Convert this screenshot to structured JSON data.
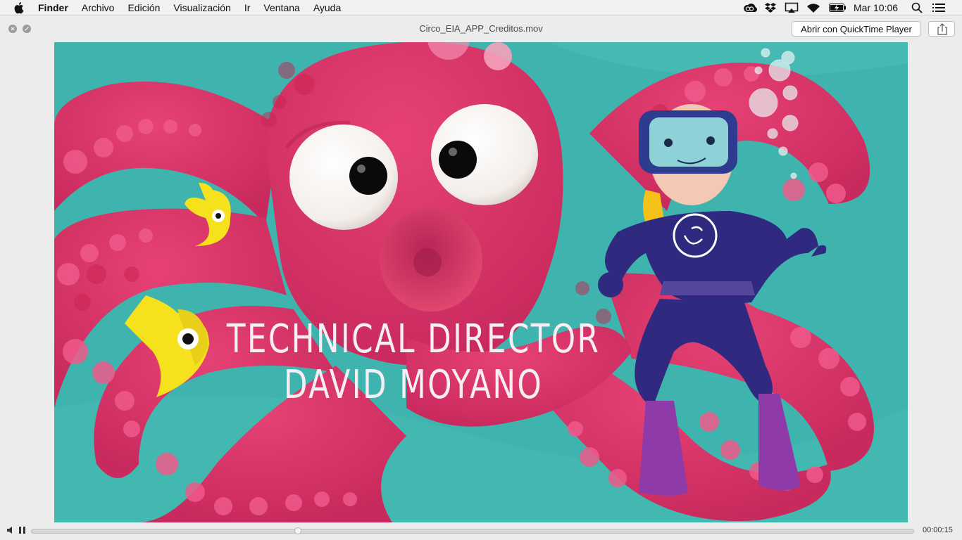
{
  "menubar": {
    "app_name": "Finder",
    "items": [
      "Archivo",
      "Edición",
      "Visualización",
      "Ir",
      "Ventana",
      "Ayuda"
    ],
    "clock": "Mar 10:06",
    "tray_icons": [
      "creative-cloud-icon",
      "dropbox-icon",
      "airplay-icon",
      "wifi-icon",
      "battery-icon",
      "search-icon",
      "list-icon"
    ]
  },
  "window": {
    "title": "Circo_EIA_APP_Creditos.mov",
    "open_button": "Abrir con QuickTime Player",
    "share_icon": "share-icon"
  },
  "video": {
    "credit_role": "TECHNICAL DIRECTOR",
    "credit_name": "DAVID MOYANO",
    "colors": {
      "water": "#3fb3ad",
      "octopus": "#d9366a",
      "diver_suit": "#2f2a80",
      "fish": "#f5e11c"
    }
  },
  "playback": {
    "time_remaining": "00:00:15",
    "progress": 0.3
  }
}
